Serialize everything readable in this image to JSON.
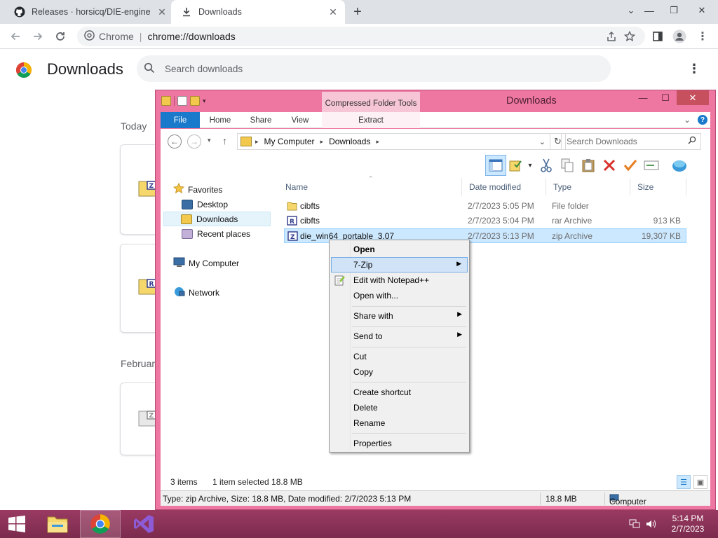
{
  "chrome": {
    "tabs": [
      {
        "title": "Releases · horsicq/DIE-engine",
        "close": "✕"
      },
      {
        "title": "Downloads",
        "close": "✕"
      }
    ],
    "new_tab": "+",
    "window_controls": {
      "chevron": "⌄",
      "restore": "❐",
      "close": "✕"
    },
    "omnibox": {
      "site_label": "Chrome",
      "separator": "|",
      "url": "chrome://downloads"
    }
  },
  "downloads_page": {
    "title": "Downloads",
    "search_placeholder": "Search downloads",
    "more": "⋮",
    "sections": [
      "Today",
      "Februar"
    ]
  },
  "explorer": {
    "title": "Downloads",
    "contextual_tab_group": "Compressed Folder Tools",
    "ribbon_tabs": [
      "File",
      "Home",
      "Share",
      "View",
      "Extract"
    ],
    "address": {
      "segments": [
        "My Computer",
        "Downloads"
      ]
    },
    "search_placeholder": "Search Downloads",
    "help": "?",
    "nav": {
      "favorites": "Favorites",
      "desktop": "Desktop",
      "downloads": "Downloads",
      "recent": "Recent places",
      "my_computer": "My Computer",
      "network": "Network"
    },
    "columns": [
      "Name",
      "Date modified",
      "Type",
      "Size"
    ],
    "files": [
      {
        "name": "cibfts",
        "date": "2/7/2023 5:05 PM",
        "type": "File folder",
        "size": ""
      },
      {
        "name": "cibfts",
        "date": "2/7/2023 5:04 PM",
        "type": "rar Archive",
        "size": "913 KB"
      },
      {
        "name": "die_win64_portable_3.07",
        "date": "2/7/2023 5:13 PM",
        "type": "zip Archive",
        "size": "19,307 KB"
      }
    ],
    "status": {
      "items": "3 items",
      "selected": "1 item selected  18.8 MB"
    },
    "details": {
      "info": "Type: zip Archive, Size: 18.8 MB, Date modified: 2/7/2023 5:13 PM",
      "size": "18.8 MB",
      "location": "Computer"
    }
  },
  "context_menu": {
    "items": [
      {
        "label": "Open"
      },
      {
        "label": "7-Zip"
      },
      {
        "label": "Edit with Notepad++"
      },
      {
        "label": "Open with..."
      },
      {
        "label": "Share with"
      },
      {
        "label": "Send to"
      },
      {
        "label": "Cut"
      },
      {
        "label": "Copy"
      },
      {
        "label": "Create shortcut"
      },
      {
        "label": "Delete"
      },
      {
        "label": "Rename"
      },
      {
        "label": "Properties"
      }
    ]
  },
  "taskbar": {
    "time": "5:14 PM",
    "date": "2/7/2023"
  },
  "colors": {
    "explorer_frame": "#ee77a2",
    "taskbar": "#8a3257",
    "ribbon_file": "#1979ca",
    "selection": "#cce8ff"
  }
}
